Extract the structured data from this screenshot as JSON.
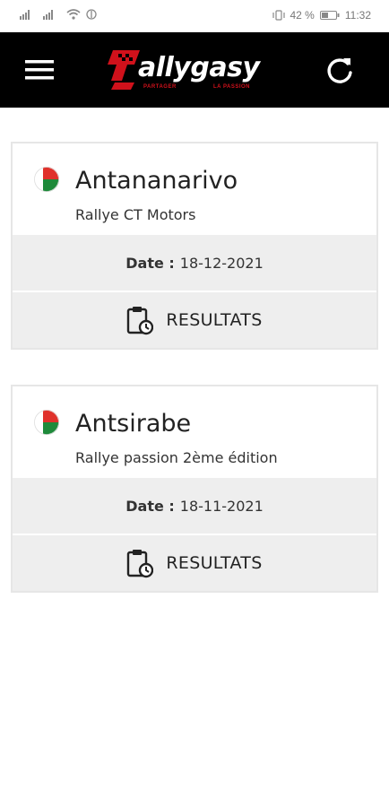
{
  "status_bar": {
    "battery_percent": "42 %",
    "time": "11:32"
  },
  "app_bar": {
    "logo_text": "allygasy",
    "logo_tag_left": "PARTAGER",
    "logo_tag_right": "LA PASSION",
    "menu_icon": "hamburger-menu-icon",
    "refresh_icon": "refresh-icon"
  },
  "rallies": [
    {
      "city": "Antananarivo",
      "event": "Rallye CT Motors",
      "date_label": "Date :",
      "date": "18-12-2021",
      "results_label": "RESULTATS",
      "flag_icon": "madagascar-flag-icon"
    },
    {
      "city": "Antsirabe",
      "event": "Rallye passion 2ème édition",
      "date_label": "Date :",
      "date": "18-11-2021",
      "results_label": "RESULTATS",
      "flag_icon": "madagascar-flag-icon"
    }
  ],
  "colors": {
    "app_bar_bg": "#000000",
    "brand_red": "#d0111b",
    "flag_red": "#e0312b",
    "flag_green": "#1e8a3a",
    "card_bg": "#eeeeee"
  }
}
